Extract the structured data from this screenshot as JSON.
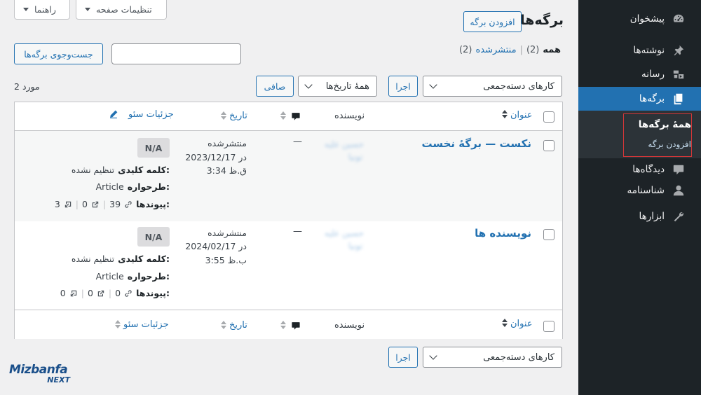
{
  "top_tabs": {
    "help": "راهنما",
    "screen_options": "تنظیمات صفحه"
  },
  "header": {
    "title": "برگه‌ها",
    "add_new": "افزودن برگه"
  },
  "subsubsub": {
    "all_label": "همه",
    "all_count": "(2)",
    "sep": "|",
    "published_label": "منتشرشده",
    "published_count": "(2)"
  },
  "search": {
    "button": "جست‌وجوی برگه‌ها",
    "value": ""
  },
  "filters": {
    "bulk_actions": "کارهای دسته‌جمعی",
    "apply": "اجرا",
    "all_dates": "همهٔ تاریخ‌ها",
    "filter": "صافی",
    "items_count": "2 مورد"
  },
  "columns": {
    "title": "عنوان",
    "author": "نویسنده",
    "date": "تاریخ",
    "seo": "جزئیات سئو"
  },
  "rows": [
    {
      "title": "نکست — برگهٔ نخست",
      "author_line1": "حسین علیه",
      "author_line2": "تونیا",
      "comments": "—",
      "date_status": "منتشرشده",
      "date_line": "2023/12/17 در",
      "time": "3:34 ق.ظ",
      "seo_score": "N/A",
      "keyword_label": "کلمه کلیدی:",
      "keyword_value": "تنظیم نشده",
      "schema_label": "طرحواره:",
      "schema_value": "Article",
      "links_label": "پیوندها:",
      "internal_links": "39",
      "external_links": "0",
      "incoming_links": "3"
    },
    {
      "title": "نویسنده ها",
      "author_line1": "حسین علیه",
      "author_line2": "تونیا",
      "comments": "—",
      "date_status": "منتشرشده",
      "date_line": "2024/02/17 در",
      "time": "3:55 ب.ظ",
      "seo_score": "N/A",
      "keyword_label": "کلمه کلیدی:",
      "keyword_value": "تنظیم نشده",
      "schema_label": "طرحواره:",
      "schema_value": "Article",
      "links_label": "پیوندها:",
      "internal_links": "0",
      "external_links": "0",
      "incoming_links": "0"
    }
  ],
  "sidebar": {
    "items": [
      {
        "label": "پیشخوان",
        "icon": "dashboard-icon"
      },
      {
        "label": "نوشته‌ها",
        "icon": "pin-icon"
      },
      {
        "label": "رسانه",
        "icon": "media-icon"
      },
      {
        "label": "برگه‌ها",
        "icon": "pages-icon"
      },
      {
        "label": "دیدگاه‌ها",
        "icon": "comments-icon"
      },
      {
        "label": "شناسنامه",
        "icon": "user-icon"
      },
      {
        "label": "ابزارها",
        "icon": "wrench-icon"
      }
    ],
    "submenu": {
      "all_pages": "همهٔ برگه‌ها",
      "add_new": "افزودن برگه"
    }
  },
  "watermark": {
    "brand": "Mizbanfa",
    "sub": "NEXT"
  },
  "colors": {
    "accent": "#2271b1",
    "sidebar_bg": "#1d2327",
    "highlight_border": "#d63638"
  }
}
